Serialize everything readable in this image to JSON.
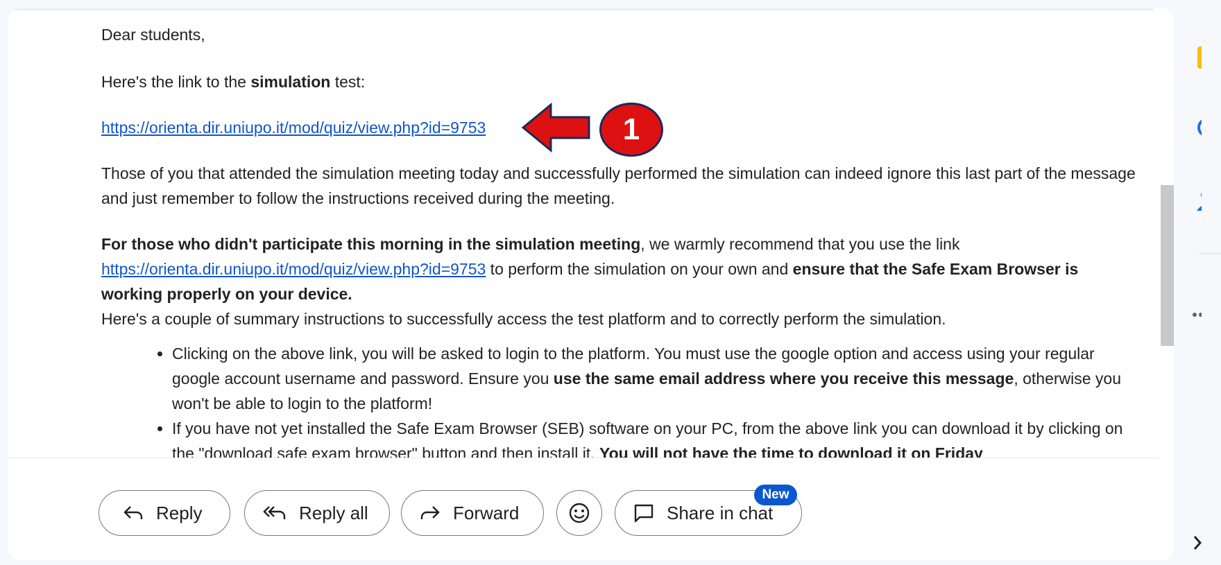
{
  "email": {
    "greeting": "Dear students,",
    "intro_prefix": "Here's the link to the ",
    "intro_bold": "simulation",
    "intro_suffix": " test:",
    "link": "https://orienta.dir.uniupo.it/mod/quiz/view.php?id=9753",
    "para2": "Those of you that attended the simulation meeting today and successfully performed the simulation can indeed ignore this last part of the message and just remember to follow the instructions received during the meeting.",
    "para3_bold": "For those who didn't participate this morning in the simulation meeting",
    "para3_mid": ", we warmly recommend that you use the link ",
    "para3_link": "https://orienta.dir.uniupo.it/mod/quiz/view.php?id=9753",
    "para3_after": " to perform the simulation on your own and ",
    "para3_bold2": "ensure that the Safe Exam Browser is working properly on your device.",
    "para4": "Here's a couple of summary instructions to successfully access the test platform and to correctly perform the simulation.",
    "bullet1_a": "Clicking on the above link, you will be asked to login to the platform. You must use the google option and access using your regular google account username and password. Ensure you ",
    "bullet1_bold": "use the same email address where you receive this message",
    "bullet1_b": ", otherwise you won't be able to login to the platform!",
    "bullet2_a": "If you have not yet installed the Safe Exam Browser (SEB) software on your PC, from the above link you can download it by clicking on the \"download safe exam browser\" button and then install it. ",
    "bullet2_bold": "You will not have the time to download it on Friday"
  },
  "annotation": {
    "marker_number": "1"
  },
  "actions": {
    "reply": "Reply",
    "reply_all": "Reply all",
    "forward": "Forward",
    "share_in_chat": "Share in chat",
    "new_badge": "New"
  },
  "side_panel": {
    "icons": [
      "keep-icon",
      "tasks-icon",
      "contacts-icon",
      "more-icon",
      "expand-icon"
    ],
    "colors": {
      "keep": "#fbbc04",
      "tasks": "#1a73e8",
      "contacts": "#1a73e8"
    }
  }
}
